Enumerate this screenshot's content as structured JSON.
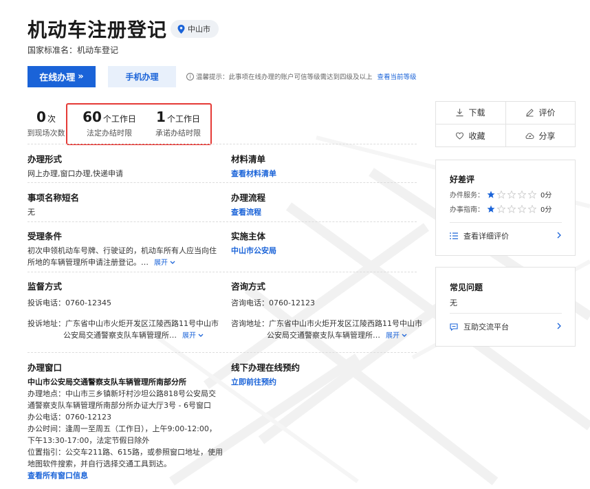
{
  "header": {
    "title": "机动车注册登记",
    "location": "中山市",
    "national_name": "国家标准名：机动车登记"
  },
  "actions_bar": {
    "online_label": "在线办理",
    "online_arrow": "»",
    "mobile_label": "手机办理",
    "tip_icon": "i",
    "tip_text": "温馨提示：此事项在线办理的账户可信等级需达到四级及以上",
    "tip_link": "查看当前等级"
  },
  "stats": [
    {
      "num": "0",
      "unit": "次",
      "label": "到现场次数"
    },
    {
      "num": "60",
      "unit": "个工作日",
      "label": "法定办结时限"
    },
    {
      "num": "1",
      "unit": "个工作日",
      "label": "承诺办结时限"
    }
  ],
  "fields": {
    "mode_title": "办理形式",
    "mode_value": "网上办理,窗口办理,快递申请",
    "materials_title": "材料清单",
    "materials_link": "查看材料清单",
    "short_title": "事项名称短名",
    "short_value": "无",
    "process_title": "办理流程",
    "process_link": "查看流程",
    "accept_title": "受理条件",
    "accept_line1": "初次申领机动车号牌、行驶证的，机动车所有人应当向住",
    "accept_line2": "所地的车辆管理所申请注册登记。…",
    "subject_title": "实施主体",
    "subject_link": "中山市公安局",
    "supervise_title": "监督方式",
    "supervise_phone": "投诉电话：0760-12345",
    "supervise_addr1": "投诉地址：广东省中山市火炬开发区江陵西路11号中山市",
    "supervise_addr2": "公安局交通警察支队车辆管理所…",
    "consult_title": "咨询方式",
    "consult_phone": "咨询电话：0760-12123",
    "consult_addr1": "咨询地址：广东省中山市火炬开发区江陵西路11号中山市",
    "consult_addr2": "公安局交通警察支队车辆管理所…",
    "expand_label": "展开",
    "expand_icon": "chevron-down-icon",
    "window_title": "办理窗口",
    "window_name": "中山市公安局交通警察支队车辆管理所南部分所",
    "window_addr1": "办理地点：中山市三乡镇新圩村沙坦公路818号公安局交",
    "window_addr2": "通警察支队车辆管理所南部分所办证大厅3号 - 6号窗口",
    "window_phone": "办公电话：0760-12123",
    "window_hours1": "办公时间：逢周一至周五（工作日），上午9:00-12:00，",
    "window_hours2": "下午13:30-17:00，法定节假日除外",
    "window_guide1": "位置指引：公交车211路、615路，或参照窗口地址，使用",
    "window_guide2": "地图软件搜索，并自行选择交通工具到达。",
    "window_all_link": "查看所有窗口信息",
    "offline_title": "线下办理在线预约",
    "offline_link": "立即前往预约"
  },
  "side_actions": {
    "download": "下载",
    "review": "评价",
    "favorite": "收藏",
    "share": "分享"
  },
  "rating": {
    "title": "好差评",
    "rows": [
      {
        "label": "办件服务：",
        "stars": 1,
        "max": 5,
        "score": "0分"
      },
      {
        "label": "办事指南：",
        "stars": 1,
        "max": 5,
        "score": "0分"
      }
    ],
    "detail_link": "查看详细评价",
    "star_on": "#1a63d8",
    "star_off": "#cfcfcf"
  },
  "faq": {
    "title": "常见问题",
    "value": "无",
    "platform_link": "互助交流平台"
  },
  "colors": {
    "primary": "#1a63d8",
    "highlight_border": "#e53935"
  }
}
